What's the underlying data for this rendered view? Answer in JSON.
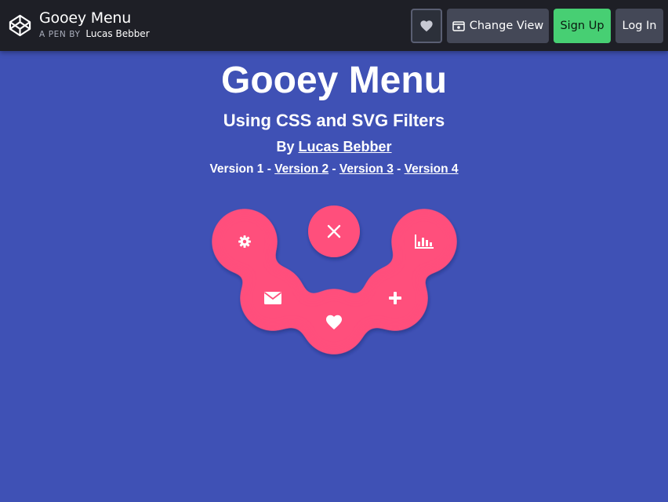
{
  "header": {
    "pen_title": "Gooey Menu",
    "pen_by_prefix": "A PEN BY",
    "author": "Lucas Bebber",
    "buttons": {
      "heart_icon": "heart-icon",
      "change_view": "Change View",
      "sign_up": "Sign Up",
      "log_in": "Log In"
    }
  },
  "page": {
    "title": "Gooey Menu",
    "subtitle": "Using CSS and SVG Filters",
    "by_prefix": "By",
    "author_link": "Lucas Bebber",
    "versions": {
      "v1": "Version 1",
      "sep": " - ",
      "v2": "Version 2",
      "v3": "Version 3",
      "v4": "Version 4"
    }
  },
  "menu": {
    "items": [
      {
        "icon": "gear-icon"
      },
      {
        "icon": "close-icon"
      },
      {
        "icon": "bar-chart-icon"
      },
      {
        "icon": "envelope-icon"
      },
      {
        "icon": "heart-icon"
      },
      {
        "icon": "plus-icon"
      }
    ]
  },
  "colors": {
    "background": "#3f51b5",
    "topbar": "#1e1f26",
    "menu_pink": "#ff4f7b",
    "signup_green": "#47cf73",
    "button_gray": "#444857"
  }
}
